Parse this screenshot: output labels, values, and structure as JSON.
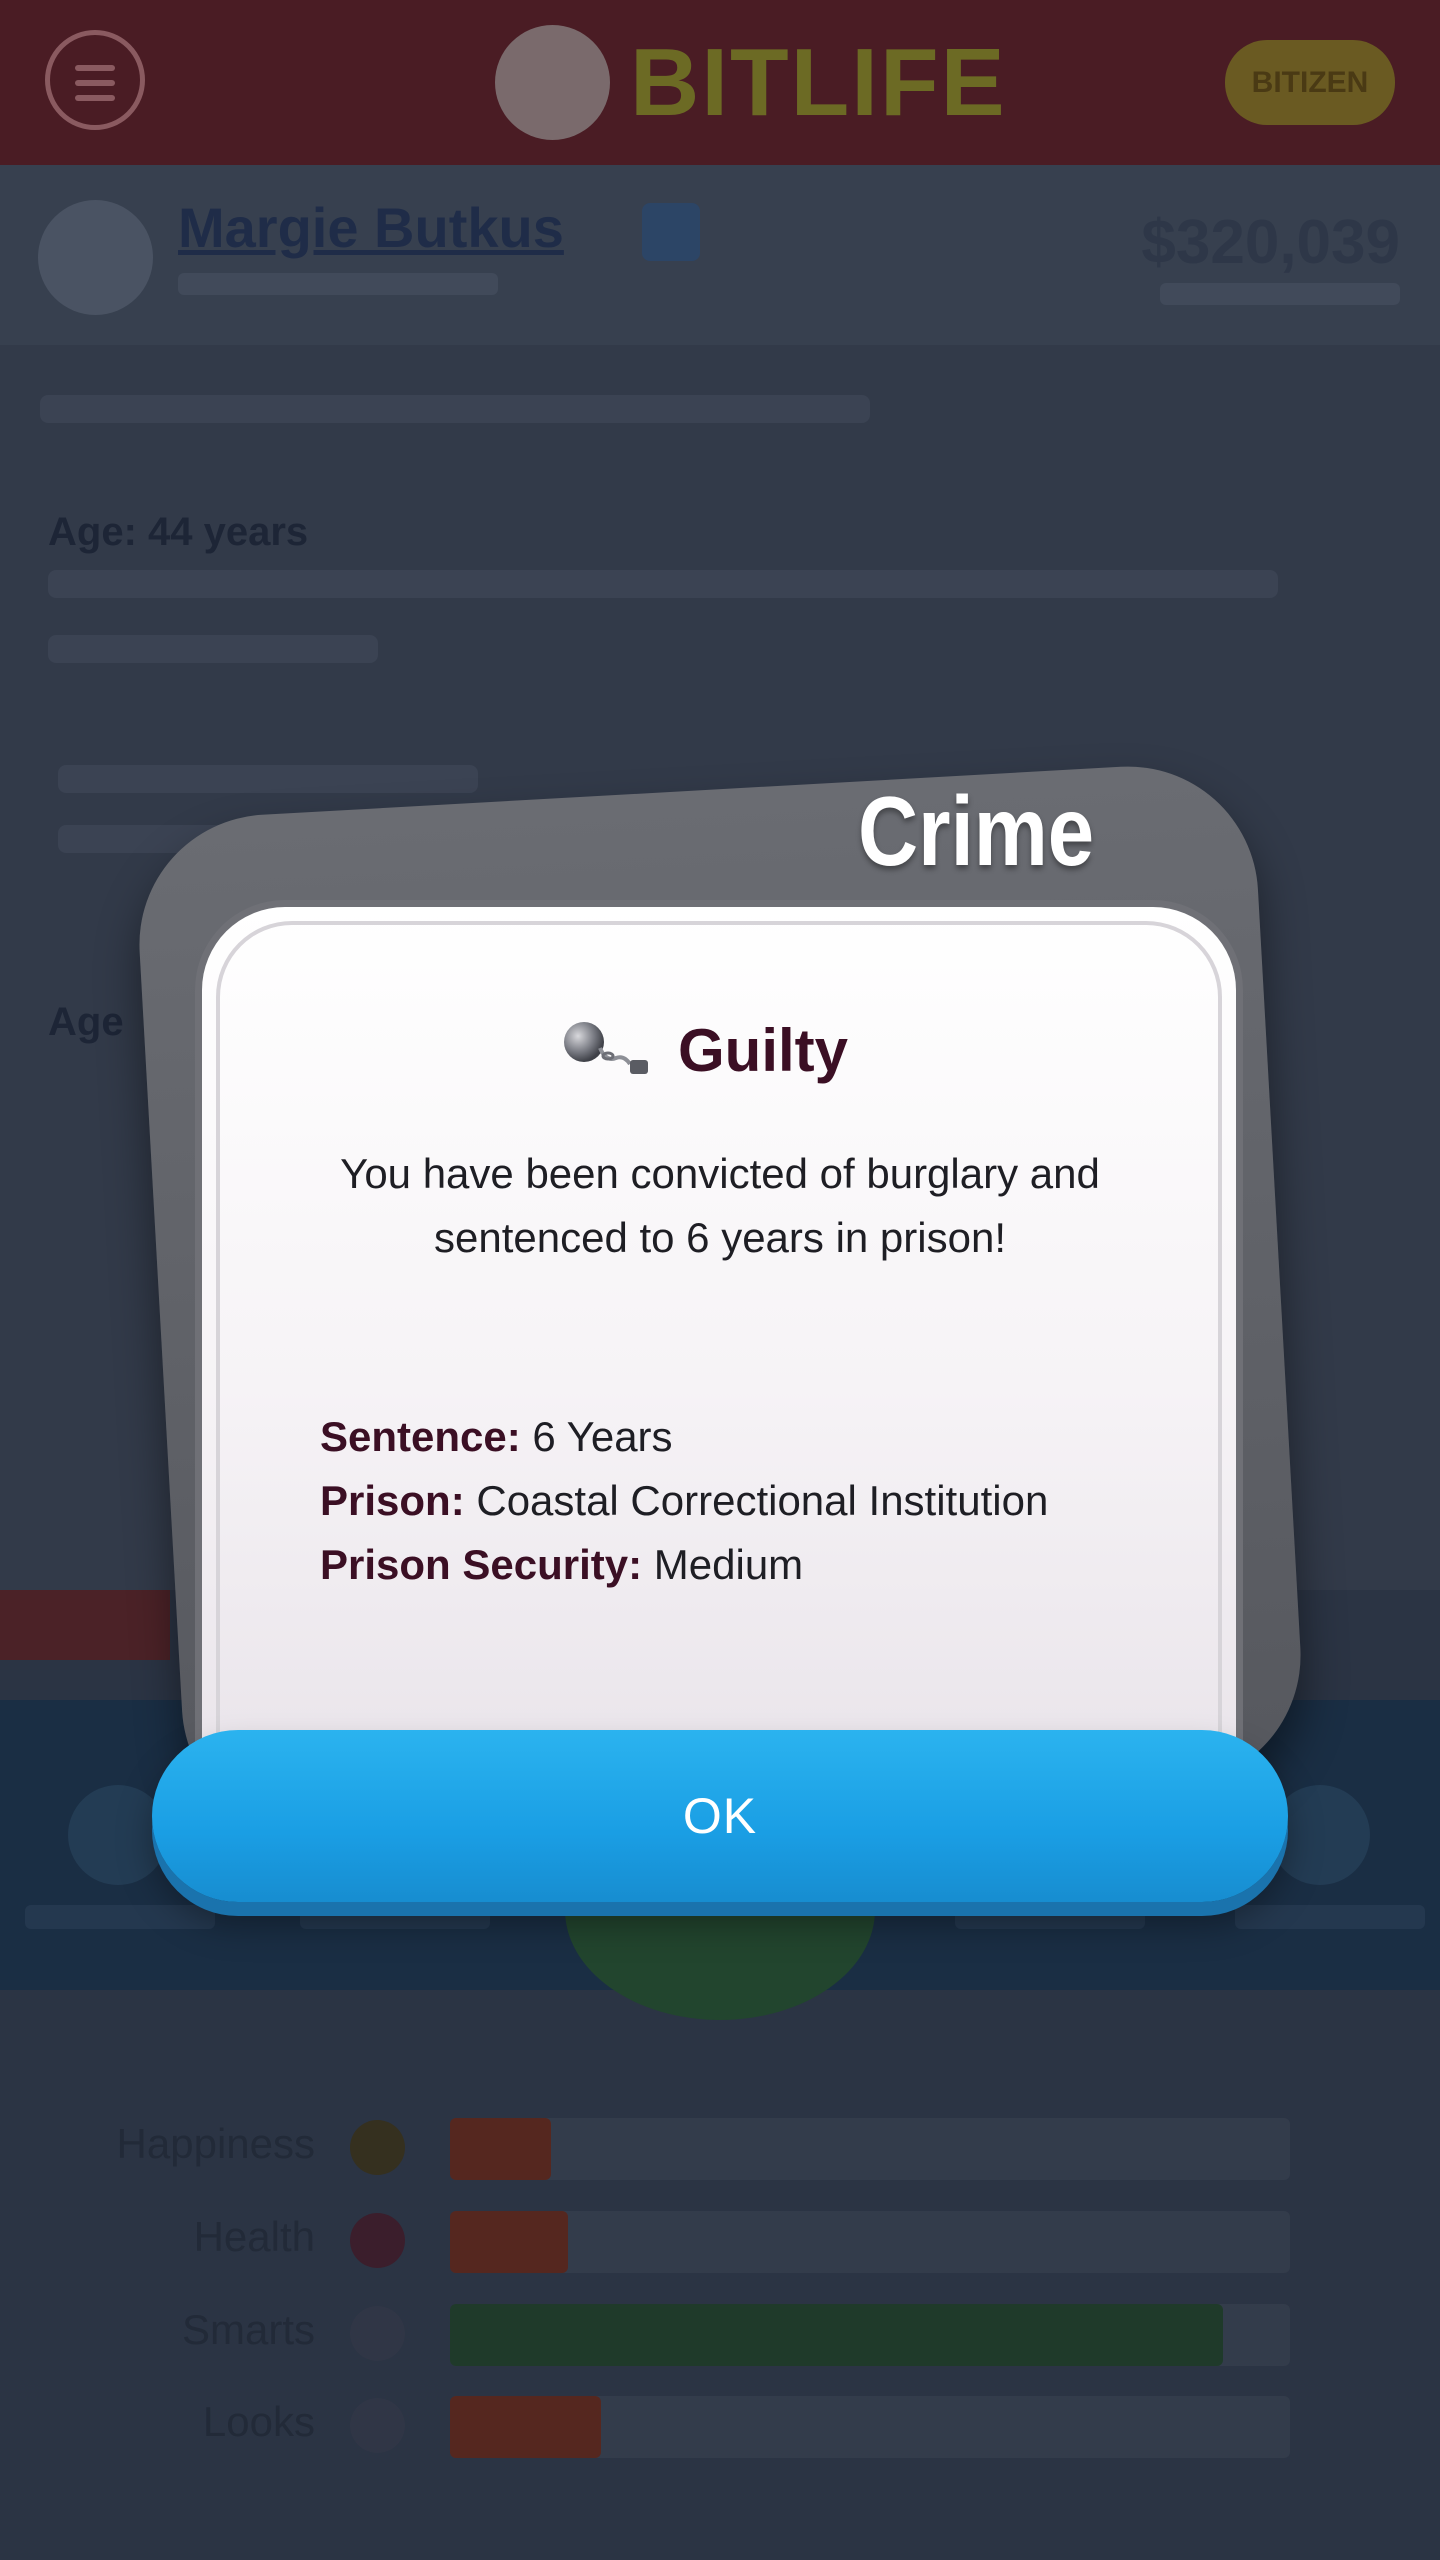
{
  "app": {
    "logo_text": "BITLIFE",
    "bitizen_label": "BITIZEN"
  },
  "profile": {
    "name": "Margie Butkus",
    "bank_balance": "$320,039"
  },
  "feed": {
    "age_heading": "Age: 44 years",
    "age_heading_2": "Age"
  },
  "dialog": {
    "category": "Crime",
    "title": "Guilty",
    "title_icon": "ball-and-chain-icon",
    "message": "You have been convicted of burglary and sentenced to 6 years in prison!",
    "details": [
      {
        "key": "Sentence:",
        "value": " 6 Years"
      },
      {
        "key": "Prison:",
        "value": " Coastal Correctional Institution"
      },
      {
        "key": "Prison Security:",
        "value": " Medium"
      }
    ],
    "ok_label": "OK"
  },
  "stats": [
    {
      "label": "Happiness",
      "icon": "smiley-icon",
      "percent": 12,
      "color": "#55271f"
    },
    {
      "label": "Health",
      "icon": "heart-icon",
      "percent": 14,
      "color": "#55271f"
    },
    {
      "label": "Smarts",
      "icon": "lightbulb-icon",
      "percent": 92,
      "color": "#1f3a2a"
    },
    {
      "label": "Looks",
      "icon": "star-icon",
      "percent": 18,
      "color": "#55271f"
    }
  ],
  "colors": {
    "accent_blue": "#1a9ee4",
    "title_maroon": "#3b0f24",
    "topbar": "#4a1c24"
  }
}
